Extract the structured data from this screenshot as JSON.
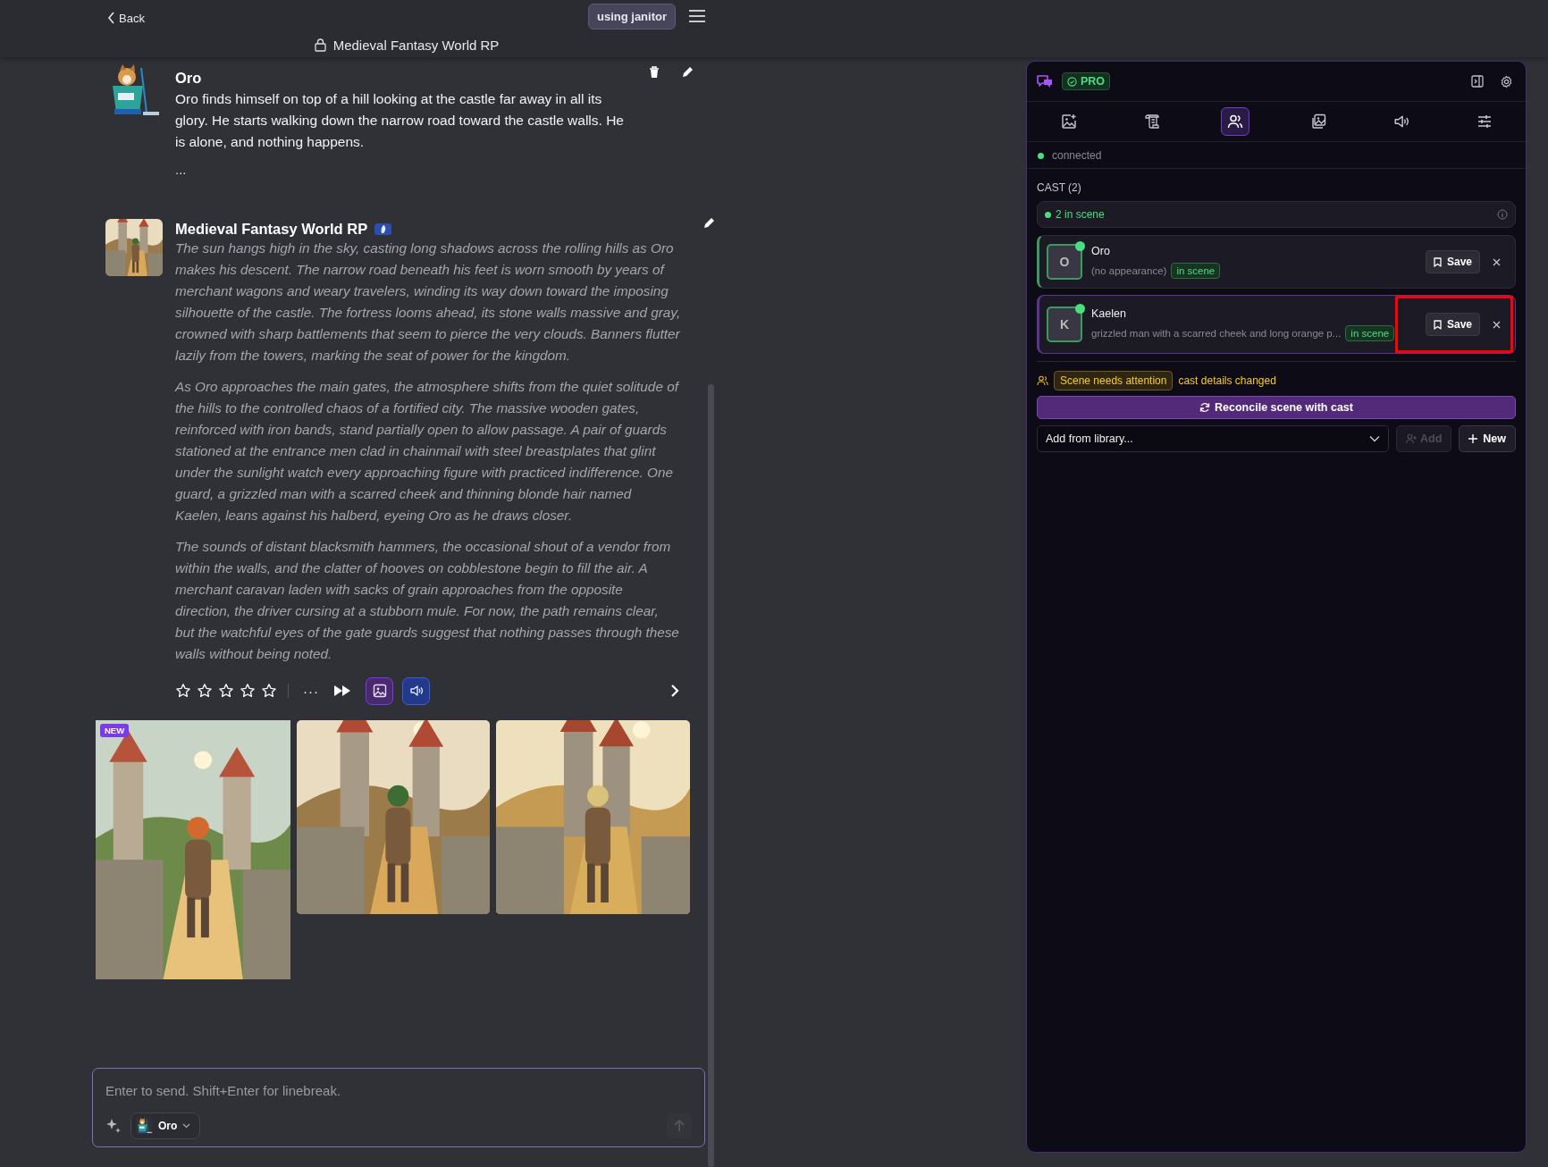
{
  "topbar": {
    "back": "Back",
    "title": "Medieval Fantasy World RP",
    "model_button": "using janitor"
  },
  "messages": [
    {
      "kind": "user",
      "name": "Oro",
      "paragraphs": [
        "Oro finds himself on top of a hill looking at the castle far away in all its glory. He starts walking down the narrow road toward the castle walls. He is alone, and nothing happens."
      ],
      "more": "..."
    },
    {
      "kind": "narrator",
      "name": "Medieval Fantasy World RP",
      "paragraphs": [
        "The sun hangs high in the sky, casting long shadows across the rolling hills as Oro makes his descent. The narrow road beneath his feet is worn smooth by years of merchant wagons and weary travelers, winding its way down toward the imposing silhouette of the castle. The fortress looms ahead, its stone walls massive and gray, crowned with sharp battlements that seem to pierce the very clouds. Banners flutter lazily from the towers, marking the seat of power for the kingdom.",
        "As Oro approaches the main gates, the atmosphere shifts from the quiet solitude of the hills to the controlled chaos of a fortified city. The massive wooden gates, reinforced with iron bands, stand partially open to allow passage. A pair of guards stationed at the entrance men clad in chainmail with steel breastplates that glint under the sunlight watch every approaching figure with practiced indifference. One guard, a grizzled man with a scarred cheek and thinning blonde hair named Kaelen, leans against his halberd, eyeing Oro as he draws closer.",
        "The sounds of distant blacksmith hammers, the occasional shout of a vendor from within the walls, and the clatter of hooves on cobblestone begin to fill the air. A merchant caravan laden with sacks of grain approaches from the opposite direction, the driver cursing at a stubborn mule. For now, the path remains clear, but the watchful eyes of the gate guards suggest that nothing passes through these walls without being noted."
      ],
      "rating": {
        "stars": 0
      },
      "more": "···",
      "images": [
        {
          "kind": "picture",
          "badge": "NEW"
        },
        {
          "kind": "picture"
        },
        {
          "kind": "picture"
        }
      ]
    }
  ],
  "composer": {
    "placeholder": "Enter to send. Shift+Enter for linebreak.",
    "persona": "Oro"
  },
  "panel": {
    "plan": "PRO",
    "tabs": [
      {
        "selected": false
      },
      {
        "selected": false
      },
      {
        "selected": true
      },
      {
        "selected": false
      },
      {
        "selected": false
      },
      {
        "selected": false
      }
    ],
    "status": "connected",
    "cast_title": "CAST (2)",
    "in_scene_summary": "2 in scene",
    "cast": [
      {
        "initial": "O",
        "name": "Oro",
        "description": "(no appearance)",
        "badge": "in scene",
        "save": "Save",
        "selected": false,
        "highlighted": false
      },
      {
        "initial": "K",
        "name": "Kaelen",
        "description": "grizzled man with a scarred cheek and long orange p...",
        "badge": "in scene",
        "save": "Save",
        "selected": true,
        "highlighted": true
      }
    ],
    "attention": {
      "badge": "Scene needs attention",
      "note": "cast details changed"
    },
    "reconcile": "Reconcile scene with cast",
    "library": {
      "value": "Add from library..."
    },
    "add": {
      "label": "Add",
      "disabled": true
    },
    "new": "New"
  }
}
